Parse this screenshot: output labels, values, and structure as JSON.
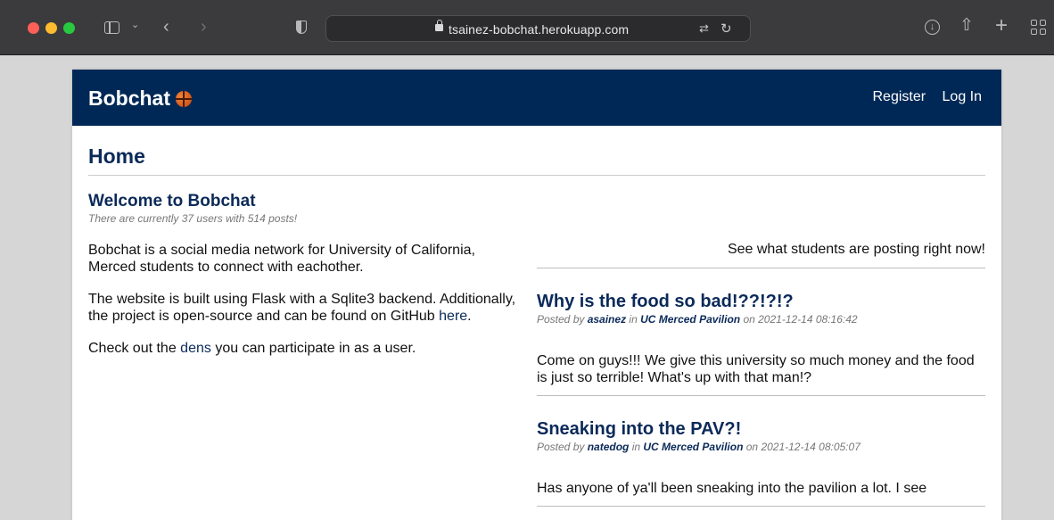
{
  "browser": {
    "url": "tsainez-bobchat.herokuapp.com"
  },
  "nav": {
    "brand": "Bobchat",
    "register": "Register",
    "login": "Log In"
  },
  "home": {
    "title": "Home",
    "welcome_title": "Welcome to Bobchat",
    "stats": "There are currently 37 users with 514 posts!"
  },
  "about": {
    "p1": "Bobchat is a social media network for University of California, Merced students to connect with eachother.",
    "p2_prefix": "The website is built using Flask with a Sqlite3 backend. Additionally, the project is open-source and can be found on GitHub ",
    "p2_link": "here",
    "p2_suffix": ".",
    "p3_prefix": "Check out the ",
    "p3_link": "dens",
    "p3_suffix": " you can participate in as a user."
  },
  "feed": {
    "teaser": "See what students are posting right now!",
    "posts": [
      {
        "title": "Why is the food so bad!??!?!?",
        "posted_by": "Posted by ",
        "author": "asainez",
        "in_text": " in ",
        "den": "UC Merced Pavilion",
        "on_text": " on ",
        "date": "2021-12-14 08:16:42",
        "body": "Come on guys!!! We give this university so much money and the food is just so terrible! What's up with that man!?"
      },
      {
        "title": "Sneaking into the PAV?!",
        "posted_by": "Posted by ",
        "author": "natedog",
        "in_text": " in ",
        "den": "UC Merced Pavilion",
        "on_text": " on ",
        "date": "2021-12-14 08:05:07",
        "body": "Has anyone of ya'll been sneaking into the pavilion a lot. I see"
      }
    ]
  },
  "colors": {
    "navbar": "#002856",
    "heading": "#0b2a59",
    "muted": "#777777"
  }
}
